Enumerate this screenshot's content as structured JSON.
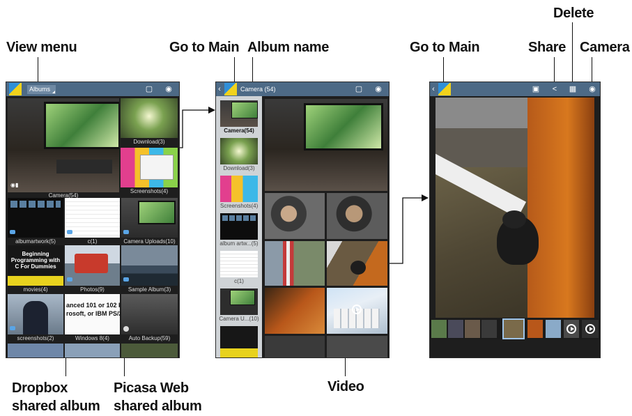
{
  "callouts": {
    "view_menu": "View menu",
    "go_to_main_1": "Go to Main",
    "album_name": "Album name",
    "go_to_main_2": "Go to Main",
    "share": "Share",
    "delete": "Delete",
    "camera": "Camera",
    "dropbox_line1": "Dropbox",
    "dropbox_line2": "shared album",
    "picasa_line1": "Picasa Web",
    "picasa_line2": "shared album",
    "video": "Video"
  },
  "screen1": {
    "dropdown_label": "Albums",
    "albums": [
      {
        "label": "Camera(54)"
      },
      {
        "label": "Download(3)"
      },
      {
        "label": "Screenshots(4)"
      },
      {
        "label": "albumartwork(5)"
      },
      {
        "label": "c(1)"
      },
      {
        "label": "Camera Uploads(10)"
      },
      {
        "label": "movies(4)"
      },
      {
        "label": "Photos(9)"
      },
      {
        "label": "Sample Album(3)"
      },
      {
        "label": "screenshots(2)"
      },
      {
        "label": "Windows 8(4)"
      },
      {
        "label": "Auto Backup(59)"
      }
    ],
    "book_text": "Beginning Programming with C For Dummies",
    "doc_text": "anced 101 or 102 k\nrosoft, or IBM PS/2"
  },
  "screen2": {
    "title": "Camera (54)",
    "side_albums": [
      {
        "label": "Camera(54)"
      },
      {
        "label": "Download(3)"
      },
      {
        "label": "Screenshots(4)"
      },
      {
        "label": "album artw...(5)"
      },
      {
        "label": "c(1)"
      },
      {
        "label": "Camera U...(10)"
      }
    ]
  },
  "icons": {
    "screen1": [
      "app-icon",
      "slideshow-icon",
      "camera-icon"
    ],
    "screen2": [
      "back-icon",
      "app-icon",
      "slideshow-icon",
      "camera-icon"
    ],
    "screen3": [
      "back-icon",
      "app-icon",
      "slideshow-icon",
      "share-icon",
      "delete-icon",
      "camera-icon"
    ]
  },
  "colors": {
    "actionbar": "#4d6a86",
    "background": "#1e1e1e",
    "callout_text": "#111111"
  }
}
